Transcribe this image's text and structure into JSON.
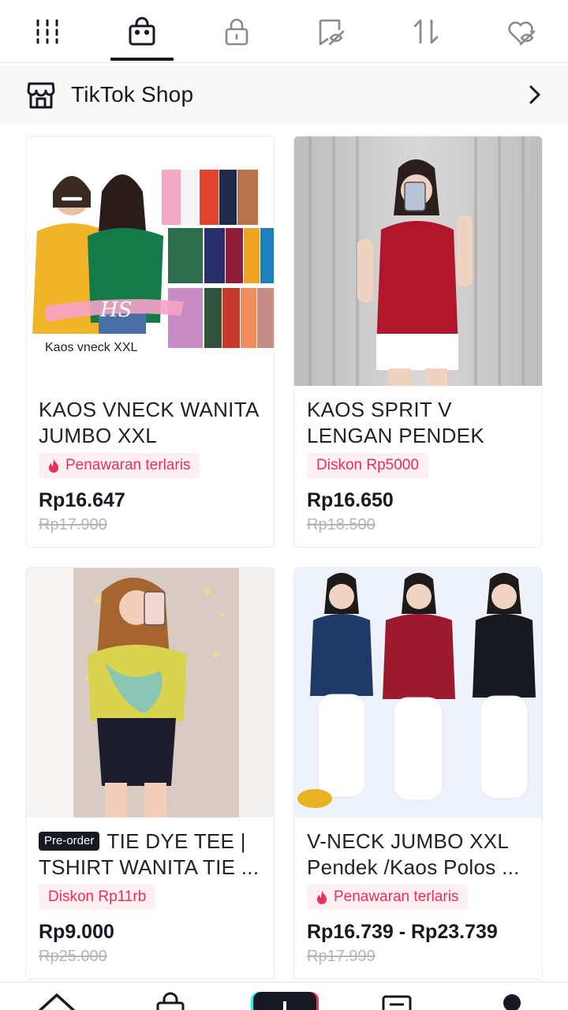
{
  "tabs": [
    {
      "name": "grid-icon",
      "selected": false
    },
    {
      "name": "shopping-bag-icon",
      "selected": true
    },
    {
      "name": "lock-icon",
      "selected": false
    },
    {
      "name": "bookmark-hidden-icon",
      "selected": false
    },
    {
      "name": "repost-icon",
      "selected": false
    },
    {
      "name": "liked-hidden-icon",
      "selected": false
    }
  ],
  "shop": {
    "title": "TikTok Shop",
    "icon": "store-icon",
    "chevron": "chevron-right-icon"
  },
  "products": [
    {
      "preorder": "",
      "title": "KAOS VNECK WANITA JUMBO XXL",
      "badge": "Penawaran terlaris",
      "badge_icon": "flame-icon",
      "price": "Rp16.647",
      "old_price": "Rp17.900",
      "image_caption": "Kaos vneck XXL"
    },
    {
      "preorder": "",
      "title": "KAOS SPRIT V LENGAN PENDEK",
      "badge": "Diskon Rp5000",
      "badge_icon": "",
      "price": "Rp16.650",
      "old_price": "Rp18.500",
      "image_caption": ""
    },
    {
      "preorder": "Pre-order",
      "title": "TIE DYE TEE | TSHIRT WANITA TIE ...",
      "badge": "Diskon Rp11rb",
      "badge_icon": "",
      "price": "Rp9.000",
      "old_price": "Rp25.000",
      "image_caption": ""
    },
    {
      "preorder": "",
      "title": "V-NECK JUMBO XXL Pendek /Kaos Polos ...",
      "badge": "Penawaran terlaris",
      "badge_icon": "flame-icon",
      "price": "Rp16.739 - Rp23.739",
      "old_price": "Rp17.999",
      "image_caption": ""
    }
  ],
  "bottom_nav": [
    "home-icon",
    "shop-icon",
    "create-icon",
    "inbox-icon",
    "profile-icon"
  ],
  "colors": {
    "text": "#161823",
    "badge_bg": "#fdeff2",
    "badge_text": "#e8305a",
    "old_price": "#b5b5b5",
    "create_cyan": "#25f4ee",
    "create_red": "#fe2c55"
  }
}
